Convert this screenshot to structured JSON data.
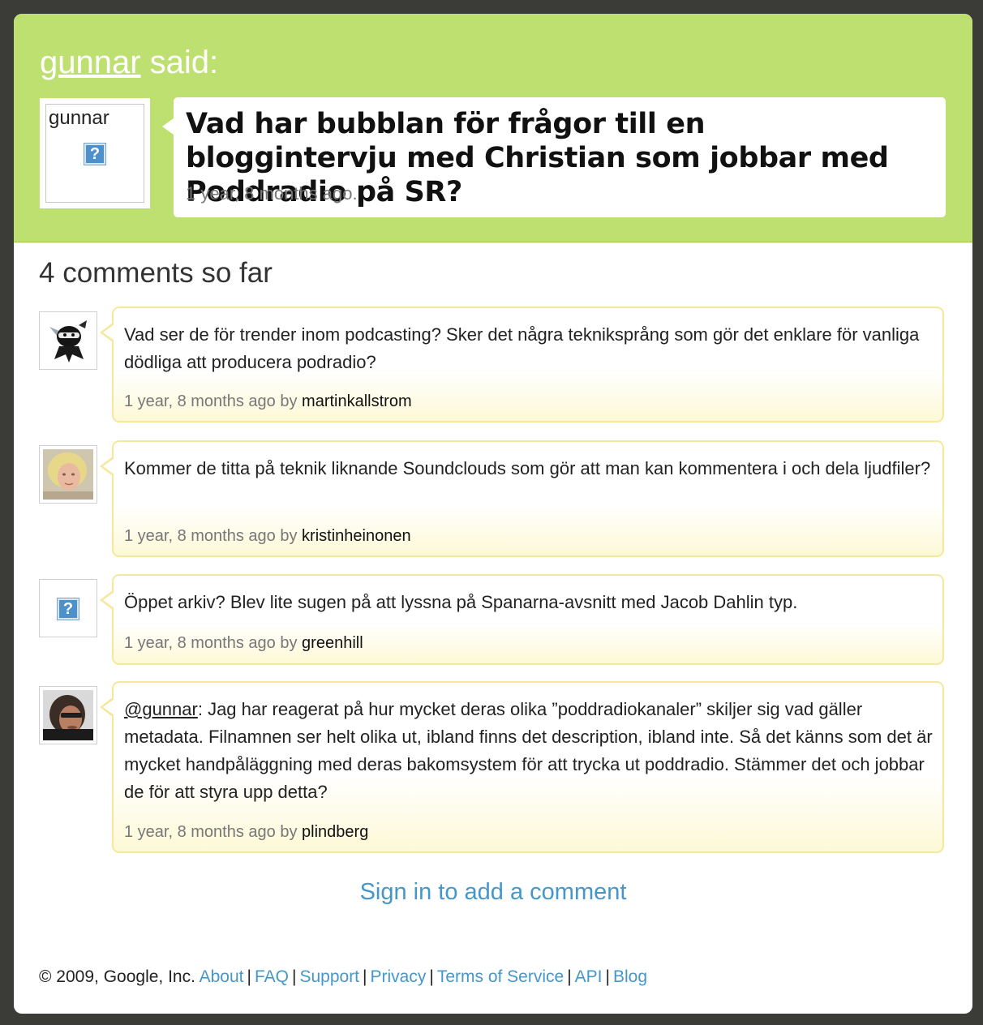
{
  "header": {
    "username": "gunnar",
    "said_suffix": " said:",
    "avatar_alt": "gunnar",
    "avatar_icon": "?",
    "question": "Vad har bubblan för frågor till en bloggintervju med Christian som jobbar med Poddradio på SR?",
    "time": "1 year, 8 months ago.",
    "bg_color": "#bde070"
  },
  "comments_heading": "4 comments so far",
  "comments": [
    {
      "text": "Vad ser de för trender inom podcasting? Sker det några tekniksprång som gör det enklare för vanliga dödliga att producera podradio?",
      "time": "1 year, 8 months ago",
      "by": " by ",
      "author": "martinkallstrom",
      "avatar": "ninja-avatar-icon"
    },
    {
      "text": "Kommer de titta på teknik liknande Soundclouds som gör att man kan kommentera i och dela ljudfiler?",
      "time": "1 year, 8 months ago",
      "by": " by ",
      "author": "kristinheinonen",
      "avatar": "photo-avatar"
    },
    {
      "text": "Öppet arkiv? Blev lite sugen på att lyssna på Spanarna-avsnitt med Jacob Dahlin typ.",
      "time": "1 year, 8 months ago",
      "by": " by ",
      "author": "greenhill",
      "avatar": "question-mark-icon",
      "avatar_icon": "?"
    },
    {
      "mention": "@gunnar",
      "text": ": Jag har reagerat på hur mycket deras olika ”poddradiokanaler” skiljer sig vad gäller metadata. Filnamnen ser helt olika ut, ibland finns det description, ibland inte. Så det känns som det är mycket handpåläggning med deras bakomsystem för att trycka ut poddradio. Stämmer det och jobbar de för att styra upp detta?",
      "time": "1 year, 8 months ago",
      "by": " by ",
      "author": "plindberg",
      "avatar": "photo-avatar"
    }
  ],
  "signin": "Sign in to add a comment",
  "footer": {
    "copyright": "© 2009, Google, Inc.",
    "links": [
      "About",
      "FAQ",
      "Support",
      "Privacy",
      "Terms of Service",
      "API",
      "Blog"
    ],
    "separator": "|"
  }
}
